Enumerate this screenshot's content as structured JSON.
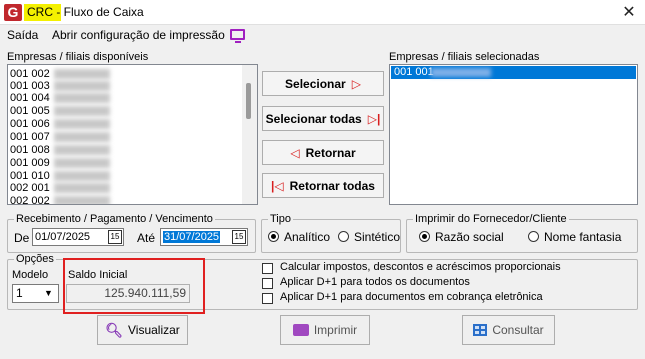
{
  "window": {
    "app_badge": "G",
    "title": "CRC - Fluxo de Caixa",
    "close_glyph": "✕"
  },
  "menu": {
    "exit": "Saída",
    "print_config": "Abrir configuração de impressão"
  },
  "available": {
    "label": "Empresas / filiais disponíveis",
    "items": [
      "001 002",
      "001 003",
      "001 004",
      "001 005",
      "001 006",
      "001 007",
      "001 008",
      "001 009",
      "001 010",
      "002 001",
      "002 002"
    ]
  },
  "selected": {
    "label": "Empresas / filiais selecionadas",
    "items": [
      "001 001"
    ]
  },
  "buttons": {
    "select": "Selecionar",
    "select_all": "Selecionar todas",
    "return": "Retornar",
    "return_all": "Retornar todas"
  },
  "dates": {
    "group_title": "Recebimento / Pagamento  / Vencimento",
    "from_label": "De",
    "from_value": "01/07/2025",
    "to_label": "Até",
    "to_value": "31/07/2025",
    "cal_glyph": "15"
  },
  "type": {
    "group_title": "Tipo",
    "analytic": "Analítico",
    "synthetic": "Sintético",
    "selected": "analytic"
  },
  "supplier": {
    "group_title": "Imprimir do Fornecedor/Cliente",
    "corporate_name": "Razão social",
    "trade_name": "Nome fantasia",
    "selected": "corporate_name"
  },
  "options": {
    "group_title": "Opções",
    "model_label": "Modelo",
    "model_value": "1",
    "balance_label": "Saldo Inicial",
    "balance_value": "125.940.111,59",
    "checks": [
      {
        "label": "Calcular impostos, descontos e acréscimos proporcionais",
        "checked": false
      },
      {
        "label": "Aplicar D+1 para todos os documentos",
        "checked": false
      },
      {
        "label": "Aplicar D+1 para documentos em cobrança eletrônica",
        "checked": false
      }
    ]
  },
  "actions": {
    "view": "Visualizar",
    "print": "Imprimir",
    "consult": "Consultar"
  },
  "colors": {
    "accent_red": "#d81d1d",
    "selection_blue": "#0078d7",
    "title_highlight": "#f4f000",
    "annotation_red": "#e02020"
  }
}
